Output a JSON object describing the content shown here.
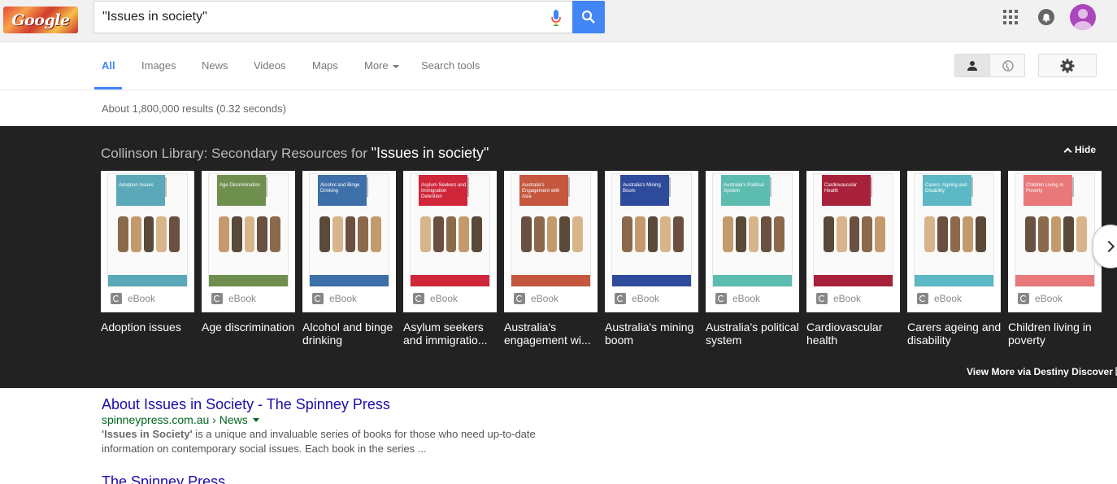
{
  "search": {
    "logo_text": "Google",
    "query": "\"Issues in society\""
  },
  "tabs": [
    {
      "label": "All",
      "active": true
    },
    {
      "label": "Images"
    },
    {
      "label": "News"
    },
    {
      "label": "Videos"
    },
    {
      "label": "Maps"
    },
    {
      "label": "More"
    },
    {
      "label": "Search tools"
    }
  ],
  "result_stats": "About 1,800,000 results (0.32 seconds)",
  "panel": {
    "title_prefix": "Collinson Library: Secondary Resources for ",
    "title_query": "\"Issues in society\"",
    "hide_label": "Hide",
    "view_more_label": "View More via Destiny Discover",
    "ebook_label": "eBook",
    "books": [
      {
        "label": "Adoption issues",
        "cover_title": "Adoption Issues",
        "color": "#5aa8b8"
      },
      {
        "label": "Age discrimination",
        "cover_title": "Age Discrimination",
        "color": "#6e8f4e"
      },
      {
        "label": "Alcohol and binge drinking",
        "cover_title": "Alcohol and Binge Drinking",
        "color": "#3d6fa8"
      },
      {
        "label": "Asylum seekers and immigratio...",
        "cover_title": "Asylum Seekers and Immigration Detention",
        "color": "#d0263a"
      },
      {
        "label": "Australia's engagement wi...",
        "cover_title": "Australia's Engagement with Asia",
        "color": "#c4573e"
      },
      {
        "label": "Australia's mining boom",
        "cover_title": "Australia's Mining Boom",
        "color": "#2e4a9a"
      },
      {
        "label": "Australia's political system",
        "cover_title": "Australia's Political System",
        "color": "#5cbcb0"
      },
      {
        "label": "Cardiovascular health",
        "cover_title": "Cardiovascular Health",
        "color": "#a8213a"
      },
      {
        "label": "Carers ageing and disability",
        "cover_title": "Carers: Ageing and Disability",
        "color": "#5bb8c4"
      },
      {
        "label": "Children living in poverty",
        "cover_title": "Children Living in Poverty",
        "color": "#e8787a"
      }
    ]
  },
  "results": [
    {
      "title": "About Issues in Society - The Spinney Press",
      "url": "spinneypress.com.au › News",
      "snippet_bold": "'Issues in Society'",
      "snippet_rest": " is a unique and invaluable series of books for those who need up-to-date information on contemporary social issues. Each book in the series ..."
    },
    {
      "title": "The Spinney Press"
    }
  ]
}
